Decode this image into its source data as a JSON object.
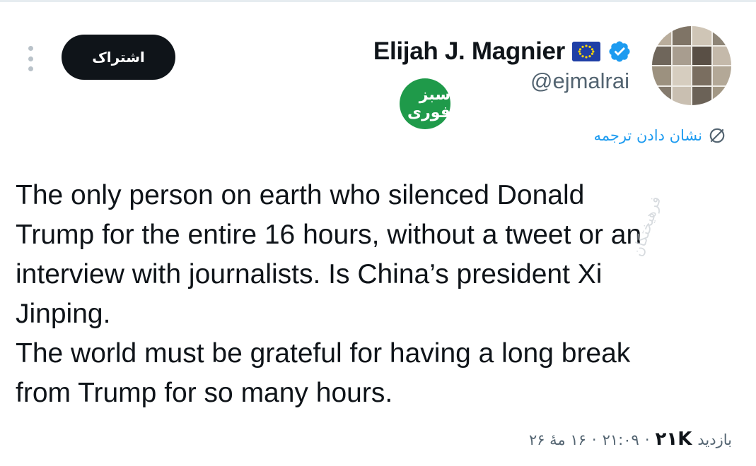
{
  "header": {
    "subscribe_label": "اشتراک",
    "display_name": "Elijah J. Magnier",
    "handle": "@ejmalrai",
    "badge_text": "سبز فوری"
  },
  "translate": {
    "label": "نشان دادن ترجمه"
  },
  "tweet": {
    "text": "The only person on earth who silenced Donald\nTrump for the entire 16 hours, without a tweet or an\ninterview with journalists. Is China’s president Xi\nJinping.\nThe world must be grateful for having a long break\nfrom Trump for so many hours."
  },
  "meta": {
    "views_label": "بازدید",
    "views_count": "۲۱K",
    "time": "۲۱:۰۹",
    "date": "۱۶ مهٔ ۲۶",
    "separator": "·"
  },
  "watermark": {
    "side_text": "فرهیختگان"
  },
  "icons": {
    "more": "more-vertical-icon",
    "flag": "eu-flag-icon",
    "verified": "verified-badge-icon",
    "translate": "globe-translate-icon"
  },
  "colors": {
    "accent": "#1d9bf0",
    "text": "#0f1419",
    "muted": "#536471",
    "button_bg": "#0f1419",
    "badge_green": "#1f9a4a"
  }
}
